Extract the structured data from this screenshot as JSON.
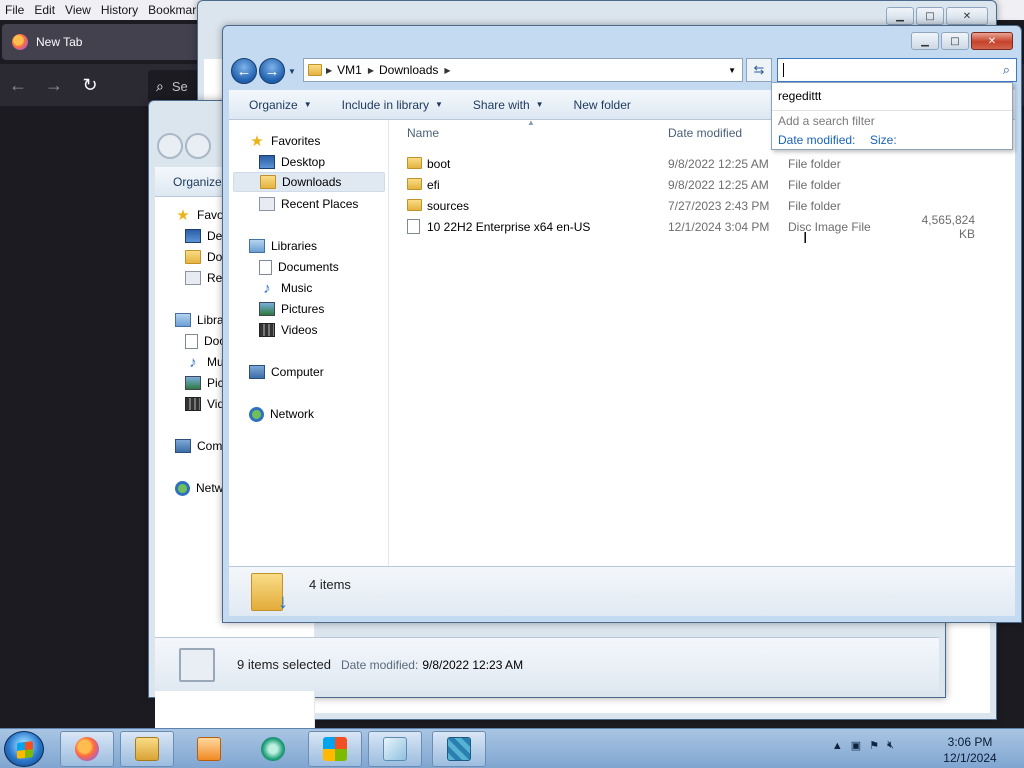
{
  "firefox": {
    "menu": [
      "File",
      "Edit",
      "View",
      "History",
      "Bookmarks"
    ],
    "tab_title": "New Tab",
    "search_hint": "Se"
  },
  "mid_window": {
    "command": "Organize",
    "nav_labels": [
      "Favo",
      "Des",
      "Dov",
      "Rec",
      "Libra",
      "Doc",
      "Mu",
      "Pic",
      "Vid",
      "Com",
      "Netw"
    ],
    "status_selected": "9 items selected",
    "status_date_label": "Date modified:",
    "status_date_value": "9/8/2022 12:23 AM"
  },
  "front_window": {
    "breadcrumb": [
      "VM1",
      "Downloads"
    ],
    "search_value": "",
    "commands": {
      "organize": "Organize",
      "include_in_library": "Include in library",
      "share_with": "Share with",
      "new_folder": "New folder"
    },
    "nav": {
      "favorites": "Favorites",
      "desktop": "Desktop",
      "downloads": "Downloads",
      "recent_places": "Recent Places",
      "libraries": "Libraries",
      "documents": "Documents",
      "music": "Music",
      "pictures": "Pictures",
      "videos": "Videos",
      "computer": "Computer",
      "network": "Network"
    },
    "columns": {
      "name": "Name",
      "date_modified": "Date modified"
    },
    "files": [
      {
        "name": "boot",
        "date": "9/8/2022 12:25 AM",
        "type": "File folder",
        "size": ""
      },
      {
        "name": "efi",
        "date": "9/8/2022 12:25 AM",
        "type": "File folder",
        "size": ""
      },
      {
        "name": "sources",
        "date": "7/27/2023 2:43 PM",
        "type": "File folder",
        "size": ""
      },
      {
        "name": "10 22H2 Enterprise x64 en-US",
        "date": "12/1/2024 3:04 PM",
        "type": "Disc Image File",
        "size": "4,565,824 KB"
      }
    ],
    "item_count": "4 items"
  },
  "search_popup": {
    "history_item": "regedittt",
    "add_filter": "Add a search filter",
    "filter_date": "Date modified:",
    "filter_size": "Size:"
  },
  "taskbar": {
    "time": "3:06 PM",
    "date": "12/1/2024"
  },
  "colors": {
    "taskbar": "#7fa6d1",
    "link_blue": "#1a63b8",
    "close_red": "#c7422b"
  }
}
